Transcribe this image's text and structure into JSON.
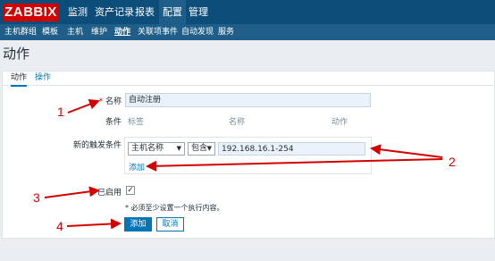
{
  "app": {
    "logo": "ZABBIX"
  },
  "main_nav": [
    "监测",
    "资产记录",
    "报表",
    "配置",
    "管理"
  ],
  "sub_nav": [
    "主机群组",
    "模板",
    "主机",
    "维护",
    "动作",
    "关联项事件",
    "自动发现",
    "服务"
  ],
  "page": {
    "title": "动作"
  },
  "tabs": [
    "动作",
    "操作"
  ],
  "form": {
    "name_label": "名称",
    "required_mark": "*",
    "name_value": "自动注册",
    "conditions_label": "条件",
    "conditions_headers": [
      "标签",
      "名称",
      "动作"
    ],
    "new_condition_label": "新的触发条件",
    "new_condition_field": "主机名称",
    "new_condition_operator": "包含",
    "new_condition_value": "192.168.16.1-254",
    "add_link": "添加",
    "enabled_label": "已启用",
    "enabled_checked": true,
    "check_mark": "✓",
    "warning": "* 必须至少设置一个执行内容。",
    "add_button": "添加",
    "cancel_button": "取消"
  },
  "annotations": [
    "1",
    "2",
    "3",
    "4"
  ],
  "colors": {
    "header": "#0d4d7a",
    "subheader": "#1f5e88",
    "logo": "#d40000",
    "accent": "#0275b8",
    "annotation": "#d40000"
  }
}
